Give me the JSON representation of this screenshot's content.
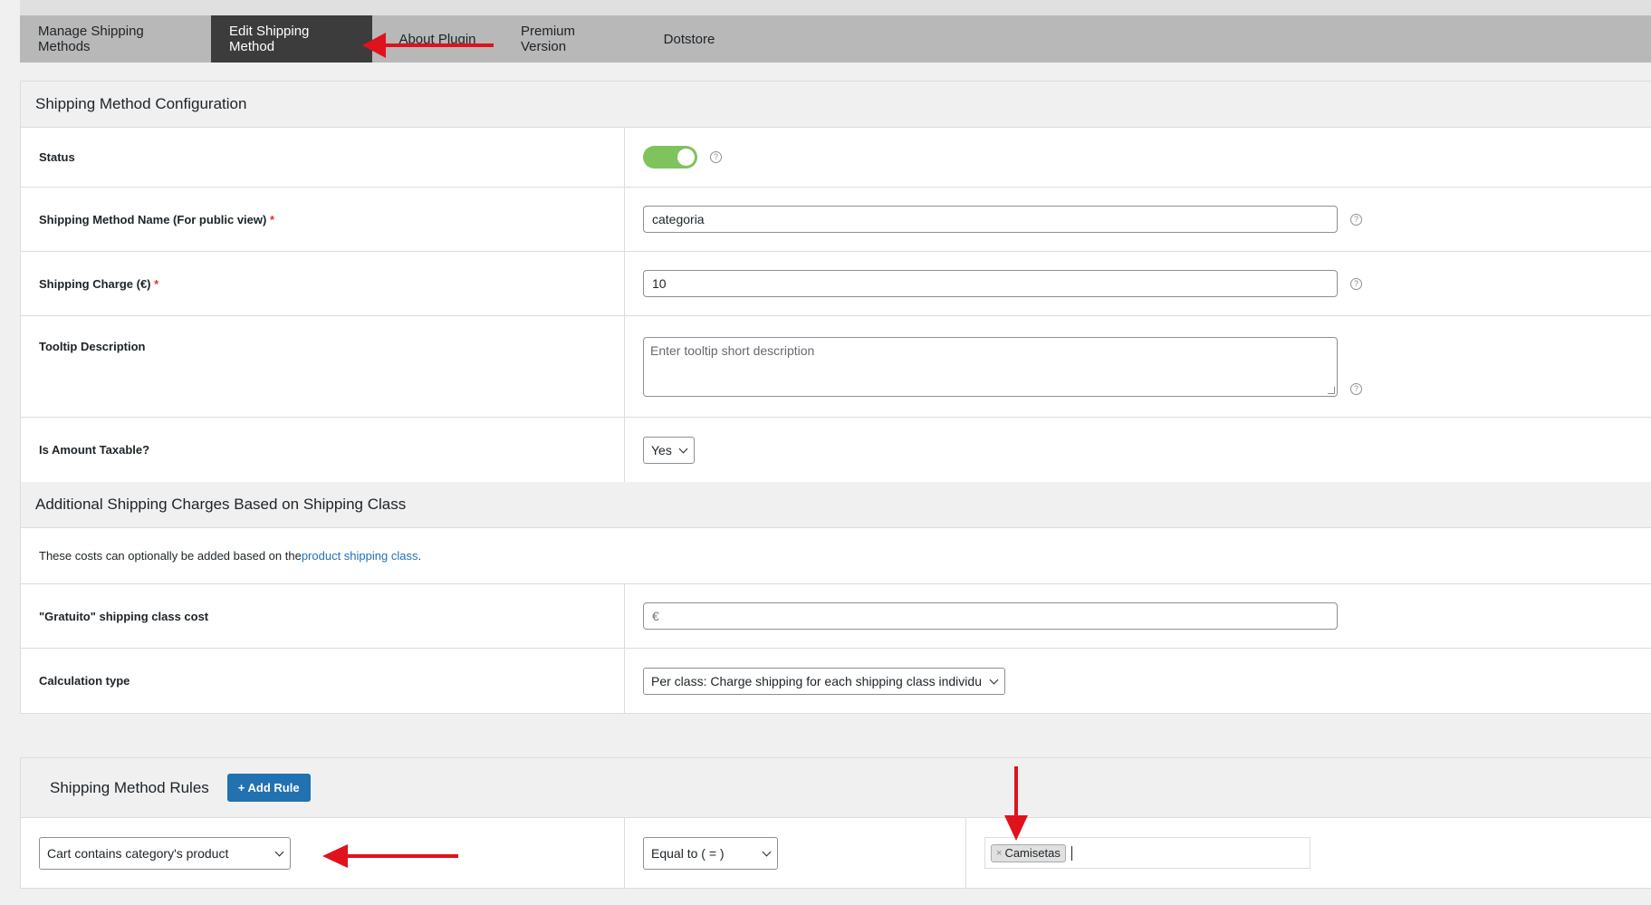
{
  "tabs": [
    {
      "label": "Manage Shipping Methods"
    },
    {
      "label": "Edit Shipping Method"
    },
    {
      "label": "About Plugin"
    },
    {
      "label": "Premium Version"
    },
    {
      "label": "Dotstore"
    }
  ],
  "config": {
    "title": "Shipping Method Configuration",
    "status_label": "Status",
    "name_label": "Shipping Method Name (For public view)",
    "name_value": "categoria",
    "charge_label": "Shipping Charge (€)",
    "charge_value": "10",
    "tooltip_label": "Tooltip Description",
    "tooltip_placeholder": "Enter tooltip short description",
    "taxable_label": "Is Amount Taxable?",
    "taxable_value": "Yes",
    "required_mark": "*",
    "help_glyph": "?"
  },
  "additional": {
    "title": "Additional Shipping Charges Based on Shipping Class",
    "intro_prefix": "These costs can optionally be added based on the ",
    "intro_link": "product shipping class",
    "intro_suffix": ".",
    "gratuito_label": "\"Gratuito\" shipping class cost",
    "gratuito_placeholder": "€",
    "calc_label": "Calculation type",
    "calc_value": "Per class: Charge shipping for each shipping class individually"
  },
  "rules": {
    "title": "Shipping Method Rules",
    "add_button": "+ Add Rule",
    "condition": "Cart contains category's product",
    "operator": "Equal to ( = )",
    "tag_remove": "×",
    "tag_value": "Camisetas"
  },
  "colors": {
    "accent": "#2271b1",
    "toggle_on": "#7ec35d",
    "annotation_arrow": "#e0121b"
  }
}
